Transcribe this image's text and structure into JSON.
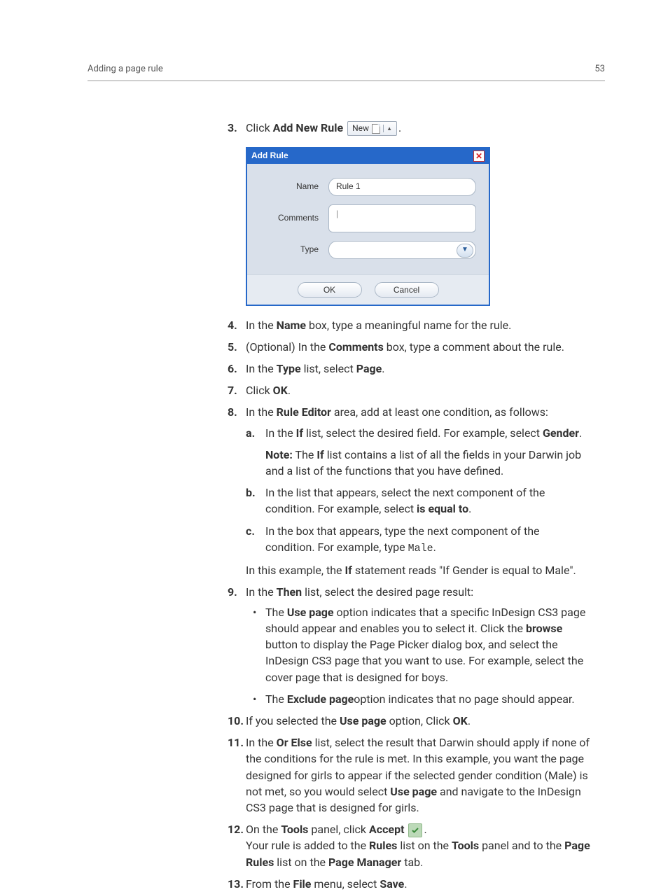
{
  "header": {
    "section_title": "Adding a page rule",
    "page_number": "53"
  },
  "toolbar_button": {
    "new_label": "New"
  },
  "dialog": {
    "title": "Add Rule",
    "name_label": "Name",
    "name_value": "Rule 1",
    "comments_label": "Comments",
    "comments_value": "",
    "type_label": "Type",
    "type_value": "",
    "ok_label": "OK",
    "cancel_label": "Cancel"
  },
  "steps": {
    "s3": {
      "num": "3.",
      "pre": "Click ",
      "bold": "Add New Rule",
      "post_icon_dot": "."
    },
    "s4": {
      "num": "4.",
      "t1": "In the ",
      "b1": "Name",
      "t2": " box, type a meaningful name for the rule."
    },
    "s5": {
      "num": "5.",
      "t1": "(Optional) In the ",
      "b1": "Comments",
      "t2": " box, type a comment about the rule."
    },
    "s6": {
      "num": "6.",
      "t1": "In the ",
      "b1": "Type",
      "t2": " list, select ",
      "b2": "Page",
      "t3": "."
    },
    "s7": {
      "num": "7.",
      "t1": "Click ",
      "b1": "OK",
      "t2": "."
    },
    "s8": {
      "num": "8.",
      "t1": "In the ",
      "b1": "Rule Editor",
      "t2": " area, add at least one condition, as follows:",
      "a": {
        "alpha": "a.",
        "t1": "In the ",
        "b1": "If",
        "t2": " list, select the desired field. For example, select ",
        "b2": "Gender",
        "t3": ".",
        "note_label": "Note:",
        "note_t1": " The ",
        "note_b1": "If",
        "note_t2": " list contains a list of all the fields in your Darwin job and a list of the functions that you have defined."
      },
      "b": {
        "alpha": "b.",
        "t1": "In the list that appears, select the next component of the condition. For example, select ",
        "b1": "is equal to",
        "t2": "."
      },
      "c": {
        "alpha": "c.",
        "t1": "In the box that appears, type the next component of the condition. For example, type ",
        "code": "Male",
        "t2": "."
      },
      "tail_t1": "In this example, the ",
      "tail_b1": "If",
      "tail_t2": " statement reads \"If Gender is equal to Male\"."
    },
    "s9": {
      "num": "9.",
      "t1": "In the ",
      "b1": "Then",
      "t2": " list, select the desired page result:",
      "u1": {
        "t1": "The ",
        "b1": "Use page",
        "t2": " option indicates that a specific InDesign CS3 page should appear and enables you to select it. Click the ",
        "b2": "browse",
        "t3": " button to display the Page Picker dialog box, and select the InDesign CS3 page that you want to use. For example, select the cover page that is designed for boys."
      },
      "u2": {
        "t1": "The ",
        "b1": "Exclude page",
        "t2": "option indicates that no page should appear."
      }
    },
    "s10": {
      "num": "10.",
      "t1": "If you selected the ",
      "b1": "Use page",
      "t2": " option, Click ",
      "b2": "OK",
      "t3": "."
    },
    "s11": {
      "num": "11.",
      "t1": "In the  ",
      "b1": "Or Else",
      "t2": " list, select the result that Darwin should apply if none of the conditions for the rule is met. In this example, you want the page designed for girls to appear if the selected gender condition (Male) is not met, so you would select ",
      "b2": "Use page",
      "t3": " and navigate to the InDesign CS3 page that is designed for girls."
    },
    "s12": {
      "num": "12.",
      "t1": "On the ",
      "b1": "Tools",
      "t2": " panel, click ",
      "b2": "Accept",
      "t3_dot": ".",
      "line2_t1": "Your rule is added to the ",
      "line2_b1": "Rules",
      "line2_t2": " list on the ",
      "line2_b2": "Tools",
      "line2_t3": " panel and to the ",
      "line2_b3": "Page Rules",
      "line2_t4": " list on the ",
      "line2_b4": "Page Manager",
      "line2_t5": " tab."
    },
    "s13": {
      "num": "13.",
      "t1": "From the ",
      "b1": "File",
      "t2": " menu, select ",
      "b2": "Save",
      "t3": "."
    }
  }
}
